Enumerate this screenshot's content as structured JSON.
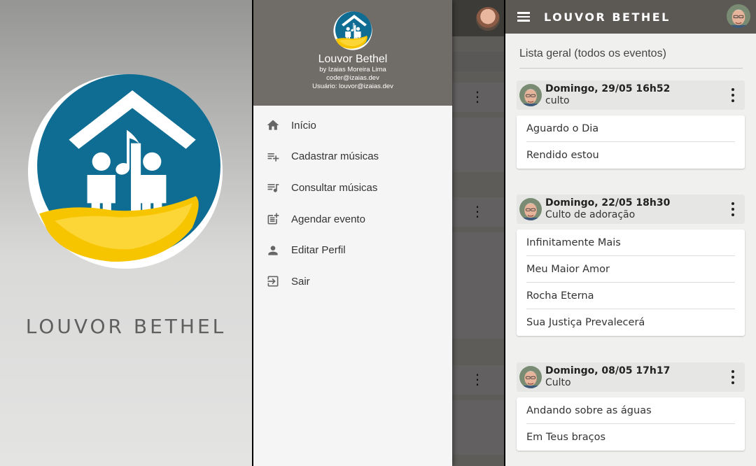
{
  "splash": {
    "title": "LOUVOR BETHEL"
  },
  "drawer": {
    "app_name": "Louvor Bethel",
    "author": "by Izaias Moreira Lima",
    "email": "coder@izaias.dev",
    "user": "Usuário: louvor@izaias.dev",
    "items": [
      {
        "label": "Início",
        "icon": "home-icon"
      },
      {
        "label": "Cadastrar músicas",
        "icon": "playlist-add-icon"
      },
      {
        "label": "Consultar músicas",
        "icon": "queue-music-icon"
      },
      {
        "label": "Agendar evento",
        "icon": "post-add-icon"
      },
      {
        "label": "Editar Perfil",
        "icon": "person-icon"
      },
      {
        "label": "Sair",
        "icon": "logout-icon"
      }
    ]
  },
  "list": {
    "appbar_title": "LOUVOR BETHEL",
    "section_title": "Lista geral (todos os eventos)",
    "events": [
      {
        "date": "Domingo, 29/05 16h52",
        "name": "culto",
        "songs": [
          "Aguardo o Dia",
          "Rendido estou"
        ]
      },
      {
        "date": "Domingo, 22/05 18h30",
        "name": "Culto de adoração",
        "songs": [
          "Infinitamente Mais",
          "Meu Maior Amor",
          "Rocha Eterna",
          "Sua Justiça Prevalecerá"
        ]
      },
      {
        "date": "Domingo, 08/05 17h17",
        "name": "Culto",
        "songs": [
          "Andando sobre as águas",
          "Em Teus braços"
        ]
      }
    ]
  },
  "colors": {
    "appbar": "#5c5955",
    "drawer_header": "#706c68",
    "logo_blue": "#0f6d94",
    "logo_yellow": "#f7c500"
  }
}
